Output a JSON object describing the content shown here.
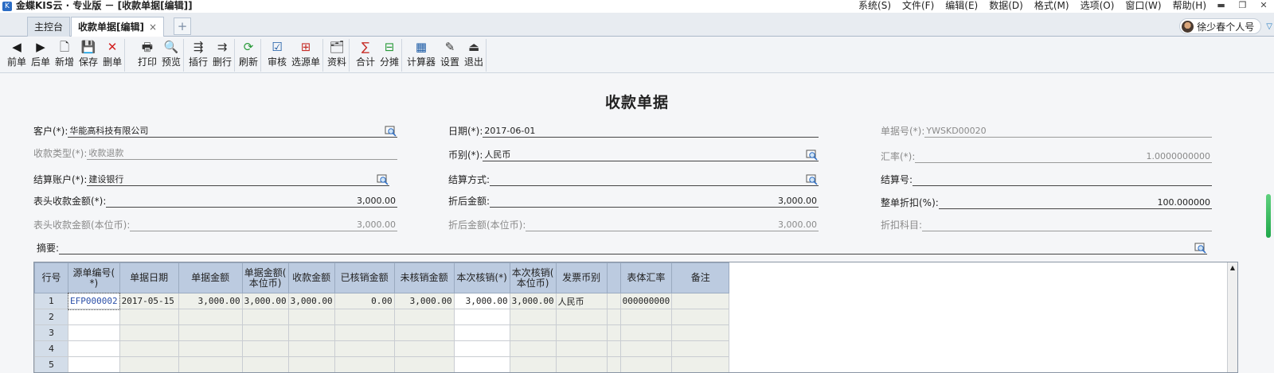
{
  "app": {
    "title": "金蝶KIS云 · 专业版 － [收款单据[编辑]]"
  },
  "menu": [
    "系统(S)",
    "文件(F)",
    "编辑(E)",
    "数据(D)",
    "格式(M)",
    "选项(O)",
    "窗口(W)",
    "帮助(H)"
  ],
  "window_controls": [
    "▬",
    "❐",
    "✕"
  ],
  "tabs": [
    {
      "label": "主控台"
    },
    {
      "label": "收款单据[编辑]"
    }
  ],
  "tab_close": "×",
  "tab_add": "+",
  "user": {
    "name": "徐少春个人号"
  },
  "toolbar": [
    {
      "label": "前单",
      "icon": "◀",
      "name": "prev-icon",
      "color": "#1a1a1a"
    },
    {
      "label": "后单",
      "icon": "▶",
      "name": "next-icon",
      "color": "#1a1a1a"
    },
    {
      "label": "新增",
      "icon": "🗋",
      "name": "new-doc-icon",
      "color": "#333333"
    },
    {
      "label": "保存",
      "icon": "💾",
      "name": "save-icon",
      "color": "#1b3f7a"
    },
    {
      "label": "删单",
      "icon": "✕",
      "name": "delete-icon",
      "color": "#d21f1f"
    },
    {
      "label": "打印",
      "icon": "🖶",
      "name": "print-icon",
      "color": "#333333"
    },
    {
      "label": "预览",
      "icon": "🔍",
      "name": "preview-icon",
      "color": "#333333"
    },
    {
      "label": "插行",
      "icon": "⇶",
      "name": "insert-row-icon",
      "color": "#333333"
    },
    {
      "label": "删行",
      "icon": "⇉",
      "name": "delete-row-icon",
      "color": "#333333"
    },
    {
      "label": "刷新",
      "icon": "⟳",
      "name": "refresh-icon",
      "color": "#2a9a3a"
    },
    {
      "label": "审核",
      "icon": "☑",
      "name": "audit-icon",
      "color": "#1b5aa5"
    },
    {
      "label": "选源单",
      "icon": "⊞",
      "name": "select-source-icon",
      "color": "#c7302a"
    },
    {
      "label": "资料",
      "icon": "🗂",
      "name": "data-icon",
      "color": "#444444"
    },
    {
      "label": "合计",
      "icon": "∑",
      "name": "sum-icon",
      "color": "#c7302a"
    },
    {
      "label": "分摊",
      "icon": "⊟",
      "name": "allocate-icon",
      "color": "#2a9a3a"
    },
    {
      "label": "计算器",
      "icon": "▦",
      "name": "calculator-icon",
      "color": "#1b5aa5"
    },
    {
      "label": "设置",
      "icon": "✎",
      "name": "settings-icon",
      "color": "#333333"
    },
    {
      "label": "退出",
      "icon": "⏏",
      "name": "exit-icon",
      "color": "#333333"
    }
  ],
  "form": {
    "title": "收款单据",
    "customer": {
      "label": "客户(*):",
      "value": "华能高科技有限公司"
    },
    "date": {
      "label": "日期(*):",
      "value": "2017-06-01"
    },
    "doc_no": {
      "label": "单据号(*):",
      "value": "YWSKD00020"
    },
    "receipt_type": {
      "label": "收款类型(*):",
      "value": "收款退款"
    },
    "currency": {
      "label": "币别(*):",
      "value": "人民币"
    },
    "exchange_rate": {
      "label": "汇率(*):",
      "value": "1.0000000000"
    },
    "settle_account": {
      "label": "结算账户(*):",
      "value": "建设银行"
    },
    "settle_method": {
      "label": "结算方式:",
      "value": ""
    },
    "settle_no": {
      "label": "结算号:",
      "value": ""
    },
    "header_amount": {
      "label": "表头收款金额(*):",
      "value": "3,000.00"
    },
    "discounted_amount": {
      "label": "折后金额:",
      "value": "3,000.00"
    },
    "discount_rate": {
      "label": "整单折扣(%):",
      "value": "100.000000"
    },
    "header_amount_local": {
      "label": "表头收款金额(本位币):",
      "value": "3,000.00"
    },
    "discounted_amount_local": {
      "label": "折后金额(本位币):",
      "value": "3,000.00"
    },
    "discount_account": {
      "label": "折扣科目:",
      "value": ""
    },
    "memo": {
      "label": "摘要:",
      "value": ""
    }
  },
  "grid": {
    "columns": [
      "行号",
      "源单编号(\n*)",
      "单据日期",
      "单据金额",
      "单据金额(\n本位币)",
      "收款金额",
      "已核销金额",
      "未核销金额",
      "本次核销(*)",
      "本次核销(\n本位币)",
      "发票币别",
      "",
      "表体汇率",
      "备注"
    ],
    "rows": [
      [
        "1",
        "EFP000002",
        "2017-05-15",
        "3,000.00",
        "3,000.00",
        "3,000.00",
        "0.00",
        "3,000.00",
        "3,000.00",
        "3,000.00",
        "人民币",
        "",
        "000000000",
        ""
      ],
      [
        "2",
        "",
        "",
        "",
        "",
        "",
        "",
        "",
        "",
        "",
        "",
        "",
        "",
        ""
      ],
      [
        "3",
        "",
        "",
        "",
        "",
        "",
        "",
        "",
        "",
        "",
        "",
        "",
        "",
        ""
      ],
      [
        "4",
        "",
        "",
        "",
        "",
        "",
        "",
        "",
        "",
        "",
        "",
        "",
        "",
        ""
      ],
      [
        "5",
        "",
        "",
        "",
        "",
        "",
        "",
        "",
        "",
        "",
        "",
        "",
        "",
        ""
      ]
    ]
  }
}
